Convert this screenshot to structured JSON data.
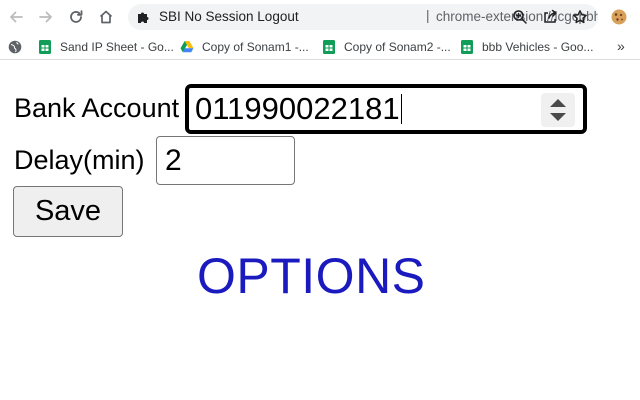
{
  "browser": {
    "tab_title": "SBI No Session Logout",
    "url_separator": "|",
    "url": "chrome-extension://icgcpbhpgi...",
    "bookmarks": [
      {
        "label": "Sand IP Sheet - Go...",
        "icon": "google-sheets-icon",
        "color": "#0f9d58"
      },
      {
        "label": "Copy of Sonam1 -...",
        "icon": "google-drive-icon",
        "color": "#fbbc04"
      },
      {
        "label": "Copy of Sonam2 -...",
        "icon": "google-sheets-icon",
        "color": "#0f9d58"
      },
      {
        "label": "bbb Vehicles - Goo...",
        "icon": "google-sheets-icon",
        "color": "#0f9d58"
      }
    ],
    "more_bookmarks": "»"
  },
  "form": {
    "bank_account_label": "Bank Account",
    "bank_account_value": "011990022181",
    "delay_label": "Delay(min)",
    "delay_value": "2",
    "save_label": "Save"
  },
  "heading": {
    "text": "OPTIONS",
    "color": "#1a1abf"
  }
}
